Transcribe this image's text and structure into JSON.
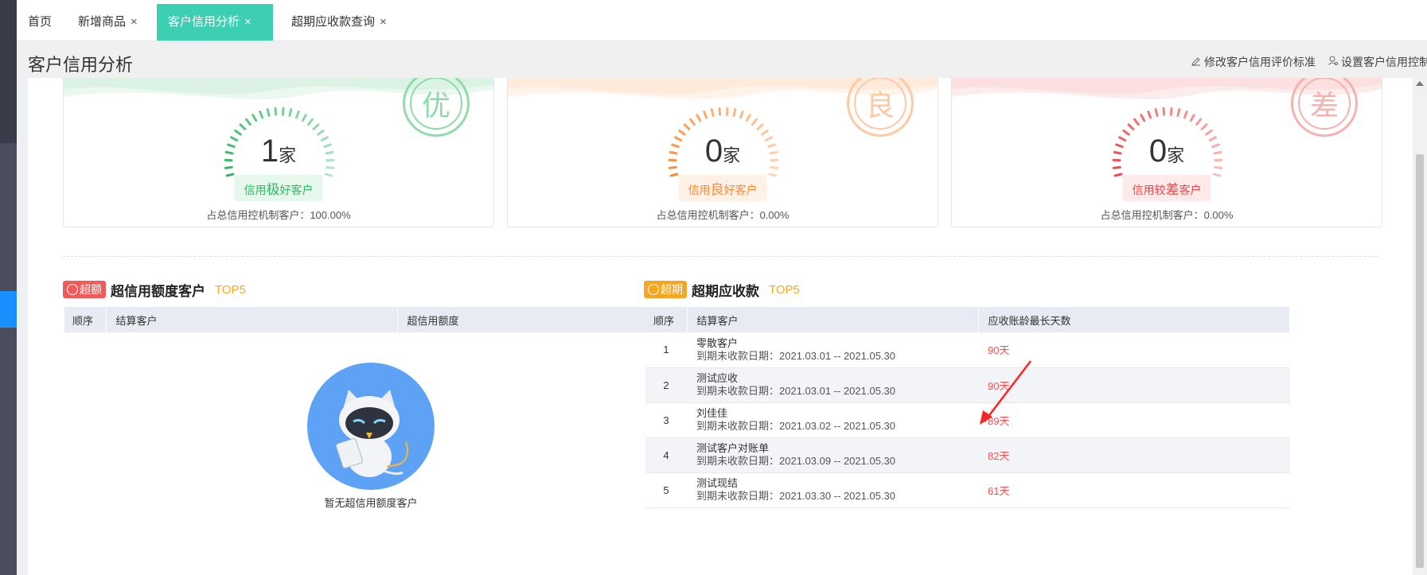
{
  "tabs": [
    {
      "label": "首页",
      "closable": false,
      "active": false
    },
    {
      "label": "新增商品",
      "closable": true,
      "active": false
    },
    {
      "label": "客户信用分析",
      "closable": true,
      "active": true
    },
    {
      "label": "超期应收款查询",
      "closable": true,
      "active": false
    }
  ],
  "close_glyph": "×",
  "header": {
    "title": "客户信用分析",
    "actions": [
      {
        "icon": "edit-icon",
        "label": "修改客户信用评价标准"
      },
      {
        "icon": "user-settings-icon",
        "label": "设置客户信用控制"
      }
    ]
  },
  "cards": [
    {
      "stamp": "优",
      "count": "1",
      "unit": "家",
      "pill_prefix": "信用",
      "pill_key": "极",
      "pill_suffix": "好客户",
      "ratio": "占总信用控机制客户：100.00%",
      "color": "#2fb865",
      "pill_bg": "#e6f7ec",
      "stamp_color": "#8fdcaa"
    },
    {
      "stamp": "良",
      "count": "0",
      "unit": "家",
      "pill_prefix": "信用",
      "pill_key": "良",
      "pill_suffix": "好客户",
      "ratio": "占总信用控机制客户：0.00%",
      "color": "#ff8a33",
      "pill_bg": "#fff1e6",
      "stamp_color": "#ffc9a3"
    },
    {
      "stamp": "差",
      "count": "0",
      "unit": "家",
      "pill_prefix": "信用较",
      "pill_key": "差",
      "pill_suffix": "客户",
      "ratio": "占总信用控机制客户：0.00%",
      "color": "#f04848",
      "pill_bg": "#fdeaea",
      "stamp_color": "#f7b1b1"
    }
  ],
  "over_credit": {
    "badge": "超额",
    "badge_color": "#f05a5a",
    "title": "超信用额度客户",
    "top": "TOP5",
    "columns": [
      "顺序",
      "结算客户",
      "超信用额度"
    ],
    "empty_text": "暂无超信用额度客户"
  },
  "overdue": {
    "badge": "超期",
    "badge_color": "#f5a623",
    "title": "超期应收款",
    "top": "TOP5",
    "columns": [
      "顺序",
      "结算客户",
      "应收账龄最长天数"
    ],
    "rows": [
      {
        "idx": "1",
        "name": "零散客户",
        "date": "到期未收款日期：2021.03.01 -- 2021.05.30",
        "days": "90天"
      },
      {
        "idx": "2",
        "name": "测试应收",
        "date": "到期未收款日期：2021.03.01 -- 2021.05.30",
        "days": "90天"
      },
      {
        "idx": "3",
        "name": "刘佳佳",
        "date": "到期未收款日期：2021.03.02 -- 2021.05.30",
        "days": "89天"
      },
      {
        "idx": "4",
        "name": "测试客户对账单",
        "date": "到期未收款日期：2021.03.09 -- 2021.05.30",
        "days": "82天"
      },
      {
        "idx": "5",
        "name": "测试现结",
        "date": "到期未收款日期：2021.03.30 -- 2021.05.30",
        "days": "61天"
      }
    ]
  }
}
